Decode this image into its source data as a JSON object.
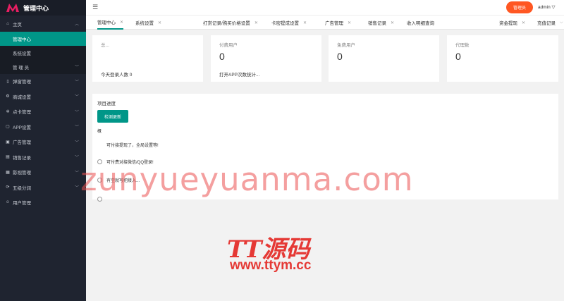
{
  "brand": {
    "title": "管理中心",
    "accent": "#e91e63"
  },
  "header": {
    "menu_icon": "hamburger-icon",
    "button_label": "管理员",
    "user": "admin ▽"
  },
  "sidebar": {
    "home": "主页",
    "sub_items": [
      "管理中心",
      "系统设置",
      "管 理 员"
    ],
    "items": [
      "弹窗管理",
      "商城设置",
      "点卡管理",
      "APP设置",
      "广告管理",
      "销售记录",
      "影视管理",
      "五级分润",
      "用户管理"
    ]
  },
  "tabs": [
    {
      "label": "管理中心",
      "close": "✕"
    },
    {
      "label": "系统设置",
      "close": "✕"
    },
    {
      "label": "打赏记录/购买价格设置",
      "close": "✕"
    },
    {
      "label": "卡密提成设置",
      "close": "✕"
    },
    {
      "label": "广告管理",
      "close": "✕"
    },
    {
      "label": "销售记录",
      "close": "✕"
    },
    {
      "label": "收入明细查询",
      "close": ""
    },
    {
      "label": "资金提现",
      "close": "✕"
    },
    {
      "label": "充值记录",
      "close": ""
    }
  ],
  "cards": [
    {
      "label": "总...",
      "value": "",
      "foot": "今天登录人数 0"
    },
    {
      "label": "付费用户",
      "value": "0",
      "foot": "打开APP次数统计..."
    },
    {
      "label": "免费用户",
      "value": "0",
      "foot": ""
    },
    {
      "label": "代理数",
      "value": "0",
      "foot": ""
    }
  ],
  "panel": {
    "title": "项目进度",
    "button": "检测更新",
    "small": "概",
    "todos": [
      "可付接提现了，全局设置等!",
      "可付费对接微信/QQ登录!",
      "有空就写把接入..."
    ]
  },
  "watermark": {
    "big": "zunyueyuanma.com",
    "logo": "TT源码",
    "url": "www.ttym.cc"
  },
  "colors": {
    "sidebar": "#1f2430",
    "active": "#009688",
    "header_button": "#ff5722"
  }
}
